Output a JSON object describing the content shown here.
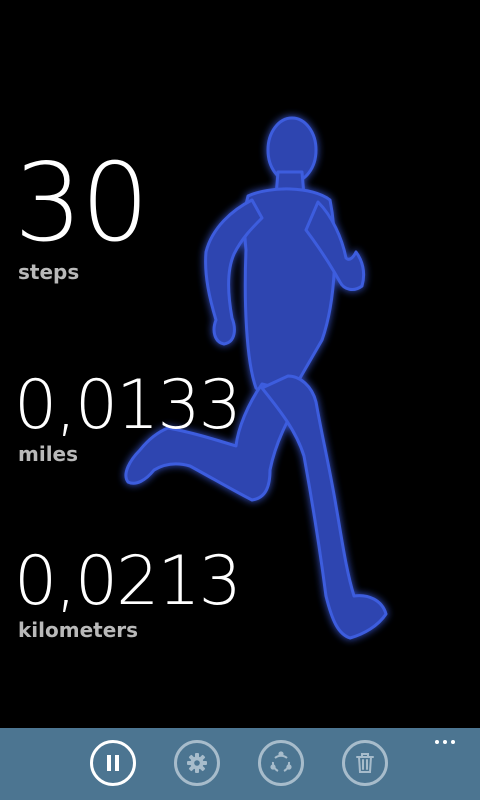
{
  "colors": {
    "background": "#000000",
    "runner": "#2e45b0",
    "appbar": "#4c7591",
    "primary_text": "#ffffff",
    "secondary_text": "#b9b9b9"
  },
  "stats": {
    "steps": {
      "value": "30",
      "unit": "steps"
    },
    "miles": {
      "value": "0,0133",
      "unit": "miles"
    },
    "kilometers": {
      "value": "0,0213",
      "unit": "kilometers"
    }
  },
  "appbar": {
    "buttons": [
      {
        "icon": "pause-icon",
        "action": "pause"
      },
      {
        "icon": "gear-icon",
        "action": "settings"
      },
      {
        "icon": "share-icon",
        "action": "share"
      },
      {
        "icon": "trash-icon",
        "action": "delete"
      }
    ],
    "more_icon": "ellipsis-icon"
  }
}
